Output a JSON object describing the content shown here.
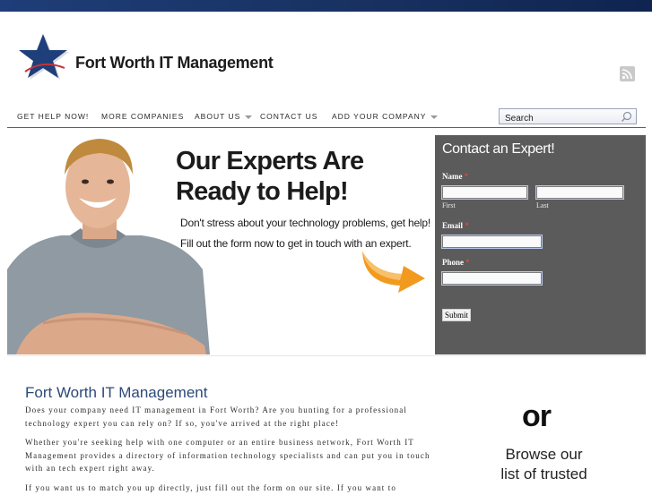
{
  "site": {
    "title": "Fort Worth IT Management"
  },
  "nav": {
    "items": [
      {
        "label": "GET HELP NOW!",
        "dropdown": false
      },
      {
        "label": "MORE COMPANIES",
        "dropdown": false
      },
      {
        "label": "ABOUT US",
        "dropdown": true
      },
      {
        "label": "CONTACT US",
        "dropdown": false
      },
      {
        "label": "ADD YOUR COMPANY",
        "dropdown": true
      }
    ],
    "search_value": "Search"
  },
  "hero": {
    "headline_line1": "Our Experts Are",
    "headline_line2": "Ready to Help!",
    "line1": "Don't stress about your technology problems, get help!",
    "line2": "Fill out the form now to get in touch with an expert."
  },
  "contact_form": {
    "title": "Contact an Expert!",
    "name_label": "Name",
    "required_mark": "*",
    "first_sub": "First",
    "last_sub": "Last",
    "email_label": "Email",
    "phone_label": "Phone",
    "submit_label": "Submit"
  },
  "main": {
    "title": "Fort Worth IT Management",
    "p1": "Does your company need IT management in Fort Worth? Are you hunting for a professional technology expert you can rely on? If so, you've arrived at the right place!",
    "p2": "Whether you're seeking help with one computer or an entire business network, Fort Worth IT Management provides a directory of information technology specialists and can put you in touch with an tech expert right away.",
    "p3": "If you want us to match you up directly, just fill out the form on our site. If you want to"
  },
  "sidebar": {
    "or_text": "or",
    "browse_line1": "Browse our",
    "browse_line2": "list of trusted"
  },
  "colors": {
    "topbar": "#17305f",
    "nav_rule": "#c2343b",
    "form_bg": "#5b5b5b",
    "title_blue": "#2c4a7a"
  }
}
